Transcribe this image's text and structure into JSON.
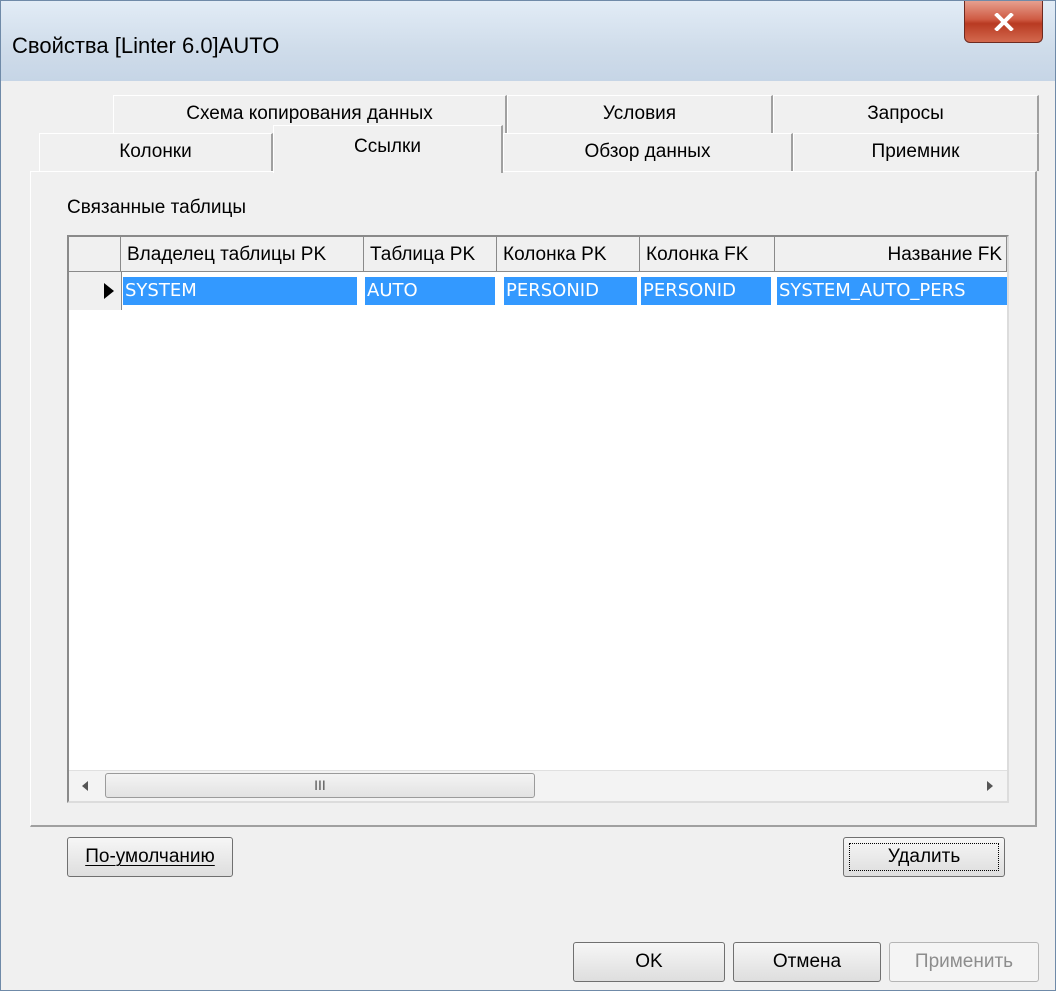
{
  "window": {
    "title": "Свойства [Linter 6.0]AUTO"
  },
  "tabs": {
    "row1": [
      {
        "label": "Схема копирования данных"
      },
      {
        "label": "Условия"
      },
      {
        "label": "Запросы"
      }
    ],
    "row2": [
      {
        "label": "Колонки"
      },
      {
        "label": "Ссылки",
        "active": true
      },
      {
        "label": "Обзор данных"
      },
      {
        "label": "Приемник"
      }
    ]
  },
  "linked_tables": {
    "label": "Связанные таблицы",
    "columns": [
      "Владелец таблицы PK",
      "Таблица PK",
      "Колонка PK",
      "Колонка FK",
      "Название FK"
    ],
    "rows": [
      [
        "SYSTEM",
        "AUTO",
        "PERSONID",
        "PERSONID",
        "SYSTEM_AUTO_PERS"
      ]
    ],
    "scroll_grip": "III"
  },
  "buttons": {
    "default": "По-умолчанию",
    "delete": "Удалить",
    "ok": "OK",
    "cancel": "Отмена",
    "apply": "Применить"
  },
  "colors": {
    "selection": "#3399ff",
    "close_button": "#c9442b"
  }
}
